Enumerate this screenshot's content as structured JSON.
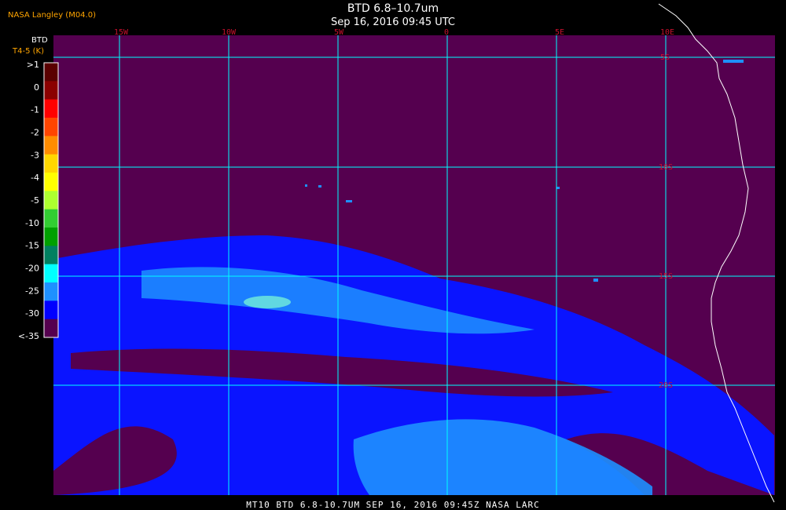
{
  "source_label": "NASA Langley (M04.0)",
  "title_line1": "BTD 6.8–10.7um",
  "title_line2": "Sep 16, 2016 09:45 UTC",
  "footer_text": "MT10  BTD 6.8-10.7UM   SEP 16, 2016 09:45Z   NASA LARC",
  "colorbar": {
    "header1": "BTD",
    "header2": "T4-5 (K)",
    "labels": [
      ">1",
      "0",
      "-1",
      "-2",
      "-3",
      "-4",
      "-5",
      "-10",
      "-15",
      "-20",
      "-25",
      "-30",
      "<-35"
    ],
    "colors": [
      "#5a0000",
      "#8b0000",
      "#ff0000",
      "#ff4500",
      "#ff8c00",
      "#ffd700",
      "#ffff00",
      "#adff2f",
      "#32cd32",
      "#00a000",
      "#008060",
      "#00ffff",
      "#1e90ff",
      "#0000ff",
      "#55004f"
    ]
  },
  "grid": {
    "lon_labels": [
      "15W",
      "10W",
      "5W",
      "0",
      "5E",
      "10E"
    ],
    "lat_labels": [
      "5S",
      "10S",
      "15S",
      "20S"
    ]
  },
  "colors": {
    "background": "#55004f",
    "cloud_dark": "#0a14ff",
    "cloud_mid": "#1e90ff",
    "gridline": "#00ffff",
    "coast": "#ffffff",
    "label": "#c8102e"
  }
}
